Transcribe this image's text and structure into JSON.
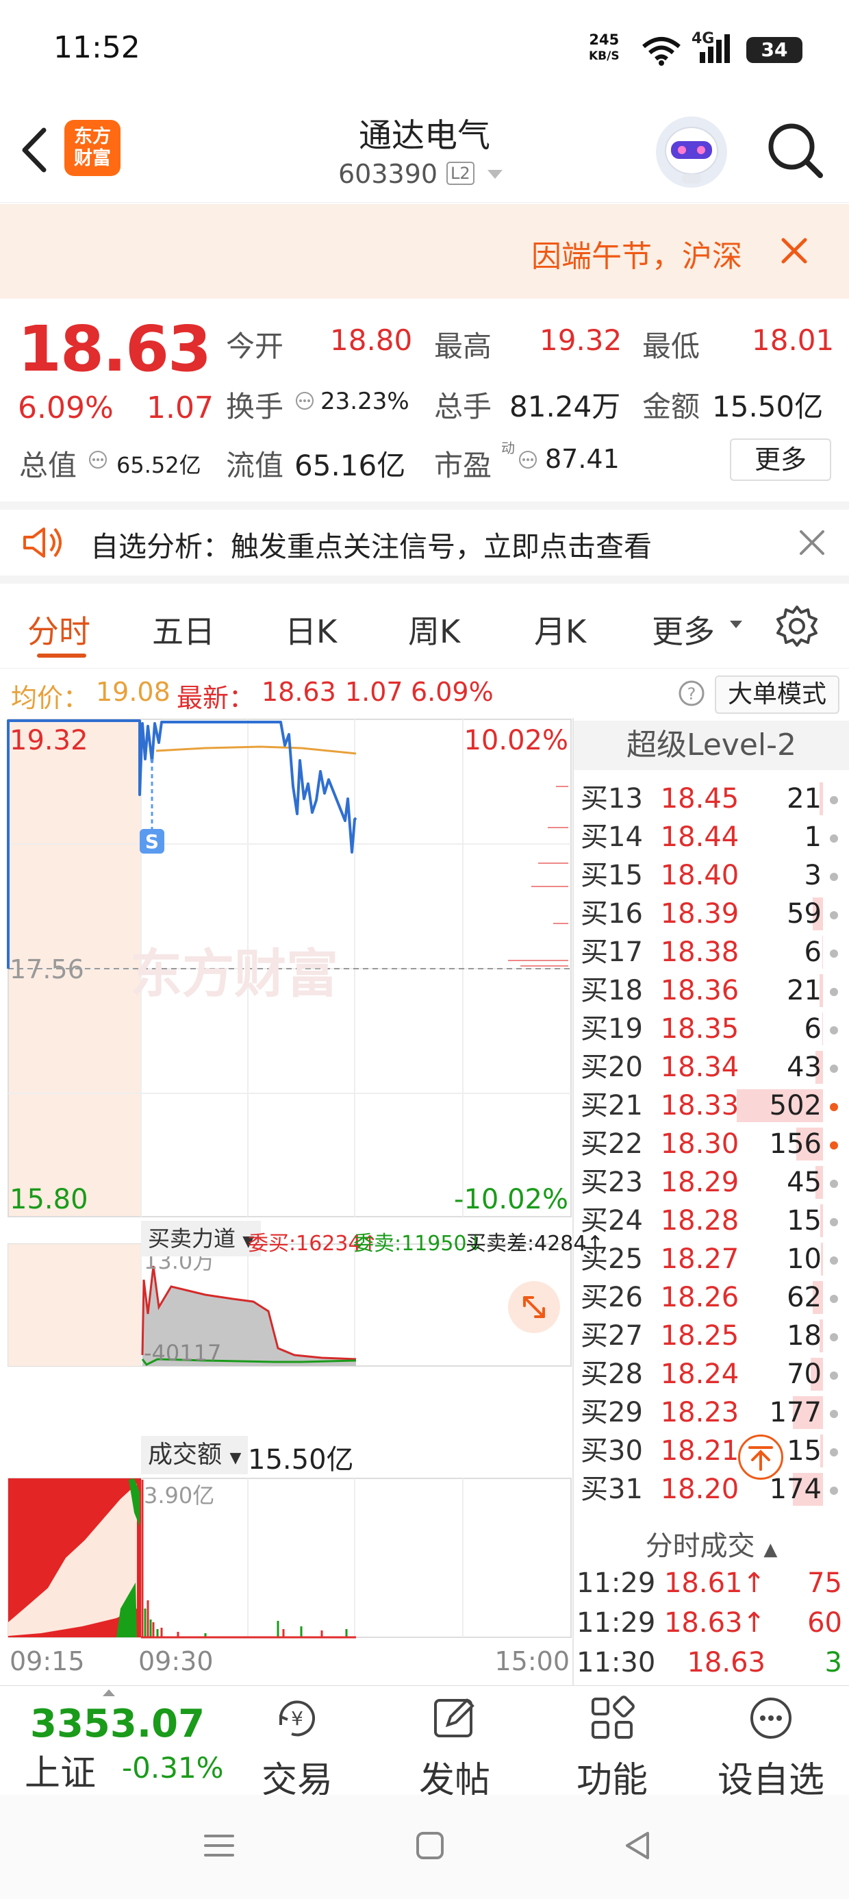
{
  "status_bar": {
    "time": "11:52",
    "net_speed": "245",
    "net_unit": "KB/S",
    "net_type": "4G",
    "battery": "34"
  },
  "header": {
    "stock_name": "通达电气",
    "stock_code": "603390",
    "level_badge": "L2",
    "logo_text": "东方财富"
  },
  "banner": {
    "text": "因端午节，沪深"
  },
  "quote": {
    "price": "18.63",
    "change_pct": "6.09%",
    "change": "1.07",
    "open_label": "今开",
    "open": "18.80",
    "high_label": "最高",
    "high": "19.32",
    "low_label": "最低",
    "low": "18.01",
    "turnover_label": "换手",
    "turnover": "23.23%",
    "volume_label": "总手",
    "volume": "81.24万",
    "amount_label": "金额",
    "amount": "15.50亿",
    "mktcap_label": "总值",
    "mktcap": "65.52亿",
    "float_label": "流值",
    "float": "65.16亿",
    "pe_label": "市盈",
    "pe_sup": "动",
    "pe": "87.41",
    "more": "更多"
  },
  "notice": {
    "text": "自选分析：触发重点关注信号，立即点击查看"
  },
  "tabs": [
    "分时",
    "五日",
    "日K",
    "周K",
    "月K",
    "更多"
  ],
  "info_bar": {
    "avg_label": "均价：",
    "avg": "19.08",
    "latest_label": "最新：",
    "latest": "18.63",
    "chg": "1.07",
    "pct": "6.09%",
    "mode_btn": "大单模式"
  },
  "chart_data": {
    "type": "line",
    "title": "",
    "y_top_price": "19.32",
    "y_mid_price": "17.56",
    "y_bottom_price": "15.80",
    "y_top_pct": "10.02%",
    "y_bottom_pct": "-10.02%",
    "x_labels": [
      "09:15",
      "09:30",
      "15:00"
    ],
    "ylim": [
      15.8,
      19.32
    ],
    "price_series": {
      "name": "最新",
      "color": "#2f6fd1"
    },
    "avg_series": {
      "name": "均价",
      "color": "#e8a13a"
    },
    "watermark": "东方财富",
    "marker": "S",
    "force_panel": {
      "title": "买卖力道",
      "buy_label": "委买:16234↑",
      "sell_label": "委卖:11950↓",
      "diff_label": "买卖差:4284↑",
      "max": "13.0万",
      "min": "-40117"
    },
    "amount_panel": {
      "title": "成交额",
      "value": "15.50亿",
      "max": "3.90亿"
    }
  },
  "level2": {
    "title": "超级Level-2",
    "rows": [
      {
        "label": "买13",
        "price": "18.45",
        "vol": "21",
        "bar": 0.04,
        "hot": false
      },
      {
        "label": "买14",
        "price": "18.44",
        "vol": "1",
        "bar": 0.0,
        "hot": false
      },
      {
        "label": "买15",
        "price": "18.40",
        "vol": "3",
        "bar": 0.0,
        "hot": false
      },
      {
        "label": "买16",
        "price": "18.39",
        "vol": "59",
        "bar": 0.12,
        "hot": false
      },
      {
        "label": "买17",
        "price": "18.38",
        "vol": "6",
        "bar": 0.01,
        "hot": false
      },
      {
        "label": "买18",
        "price": "18.36",
        "vol": "21",
        "bar": 0.04,
        "hot": false
      },
      {
        "label": "买19",
        "price": "18.35",
        "vol": "6",
        "bar": 0.01,
        "hot": false
      },
      {
        "label": "买20",
        "price": "18.34",
        "vol": "43",
        "bar": 0.09,
        "hot": false
      },
      {
        "label": "买21",
        "price": "18.33",
        "vol": "502",
        "bar": 1.0,
        "hot": true
      },
      {
        "label": "买22",
        "price": "18.30",
        "vol": "156",
        "bar": 0.31,
        "hot": true
      },
      {
        "label": "买23",
        "price": "18.29",
        "vol": "45",
        "bar": 0.09,
        "hot": false
      },
      {
        "label": "买24",
        "price": "18.28",
        "vol": "15",
        "bar": 0.03,
        "hot": false
      },
      {
        "label": "买25",
        "price": "18.27",
        "vol": "10",
        "bar": 0.02,
        "hot": false
      },
      {
        "label": "买26",
        "price": "18.26",
        "vol": "62",
        "bar": 0.12,
        "hot": false
      },
      {
        "label": "买27",
        "price": "18.25",
        "vol": "18",
        "bar": 0.04,
        "hot": false
      },
      {
        "label": "买28",
        "price": "18.24",
        "vol": "70",
        "bar": 0.14,
        "hot": false
      },
      {
        "label": "买29",
        "price": "18.23",
        "vol": "177",
        "bar": 0.35,
        "hot": false
      },
      {
        "label": "买30",
        "price": "18.21",
        "vol": "15",
        "bar": 0.03,
        "hot": false
      },
      {
        "label": "买31",
        "price": "18.20",
        "vol": "174",
        "bar": 0.35,
        "hot": false
      }
    ]
  },
  "trades": {
    "title": "分时成交",
    "rows": [
      {
        "time": "11:29",
        "price": "18.61↑",
        "vol": "75",
        "dir": "red"
      },
      {
        "time": "11:29",
        "price": "18.63↑",
        "vol": "60",
        "dir": "red"
      },
      {
        "time": "11:30",
        "price": "18.63",
        "vol": "3",
        "dir": "green"
      }
    ]
  },
  "bottom_nav": {
    "index_value": "3353.07",
    "index_name": "上证",
    "index_pct": "-0.31%",
    "items": [
      "交易",
      "发帖",
      "功能",
      "设自选"
    ]
  }
}
